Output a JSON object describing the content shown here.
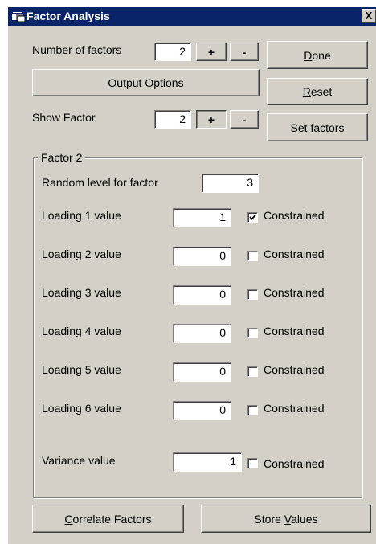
{
  "window": {
    "title": "Factor Analysis",
    "close_label": "X"
  },
  "top": {
    "num_factors_label": "Number of factors",
    "num_factors_value": "2",
    "plus_label": "+",
    "minus_label": "-",
    "output_options_label": "Output Options",
    "show_factor_label": "Show Factor",
    "show_factor_value": "2"
  },
  "side_buttons": {
    "done": "Done",
    "reset": "Reset",
    "set_factors": "Set factors"
  },
  "group": {
    "legend": "Factor 2",
    "random_level_label": "Random level for factor",
    "random_level_value": "3",
    "constrained_label": "Constrained",
    "loadings": [
      {
        "label": "Loading 1 value",
        "value": "1",
        "constrained": true
      },
      {
        "label": "Loading 2 value",
        "value": "0",
        "constrained": false
      },
      {
        "label": "Loading 3 value",
        "value": "0",
        "constrained": false
      },
      {
        "label": "Loading 4 value",
        "value": "0",
        "constrained": false
      },
      {
        "label": "Loading 5 value",
        "value": "0",
        "constrained": false
      },
      {
        "label": "Loading 6 value",
        "value": "0",
        "constrained": false
      }
    ],
    "variance_label": "Variance value",
    "variance_value": "1",
    "variance_constrained": false
  },
  "bottom": {
    "correlate_label": "Correlate Factors",
    "store_label": "Store Values"
  }
}
